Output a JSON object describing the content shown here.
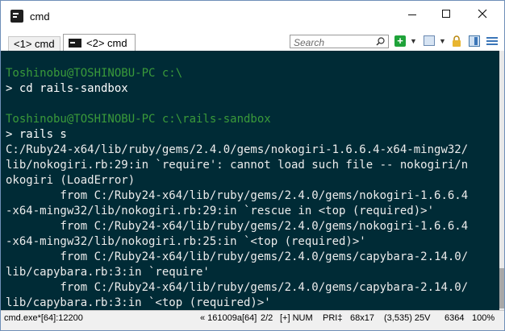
{
  "window": {
    "title": "cmd"
  },
  "tabs": [
    {
      "label": "<1> cmd"
    },
    {
      "label": "<2> cmd"
    }
  ],
  "search": {
    "placeholder": "Search"
  },
  "console": {
    "lines": [
      {
        "text": "",
        "color": "white"
      },
      {
        "text": "Toshinobu@TOSHINOBU-PC c:\\",
        "color": "green"
      },
      {
        "text": "> cd rails-sandbox",
        "color": "white"
      },
      {
        "text": "",
        "color": "white"
      },
      {
        "text": "Toshinobu@TOSHINOBU-PC c:\\rails-sandbox",
        "color": "green"
      },
      {
        "text": "> rails s",
        "color": "white"
      },
      {
        "text": "C:/Ruby24-x64/lib/ruby/gems/2.4.0/gems/nokogiri-1.6.6.4-x64-mingw32/",
        "color": "light"
      },
      {
        "text": "lib/nokogiri.rb:29:in `require': cannot load such file -- nokogiri/n",
        "color": "light"
      },
      {
        "text": "okogiri (LoadError)",
        "color": "light"
      },
      {
        "text": "        from C:/Ruby24-x64/lib/ruby/gems/2.4.0/gems/nokogiri-1.6.6.4",
        "color": "light"
      },
      {
        "text": "-x64-mingw32/lib/nokogiri.rb:29:in `rescue in <top (required)>'",
        "color": "light"
      },
      {
        "text": "        from C:/Ruby24-x64/lib/ruby/gems/2.4.0/gems/nokogiri-1.6.6.4",
        "color": "light"
      },
      {
        "text": "-x64-mingw32/lib/nokogiri.rb:25:in `<top (required)>'",
        "color": "light"
      },
      {
        "text": "        from C:/Ruby24-x64/lib/ruby/gems/2.4.0/gems/capybara-2.14.0/",
        "color": "light"
      },
      {
        "text": "lib/capybara.rb:3:in `require'",
        "color": "light"
      },
      {
        "text": "        from C:/Ruby24-x64/lib/ruby/gems/2.4.0/gems/capybara-2.14.0/",
        "color": "light"
      },
      {
        "text": "lib/capybara.rb:3:in `<top (required)>'",
        "color": "light"
      }
    ]
  },
  "statusbar": {
    "process": "cmd.exe*[64]:12200",
    "hwnd": "« 161009a[64]",
    "tab_index": "2/2",
    "insert": "[+] NUM",
    "pri": "PRI‡",
    "size": "68x17",
    "cursor": "(3,535) 25V",
    "pid": "6364",
    "zoom": "100%"
  },
  "colors": {
    "console_bg": "#002b36",
    "prompt_green": "#3a9a3a",
    "text": "#ececec"
  }
}
